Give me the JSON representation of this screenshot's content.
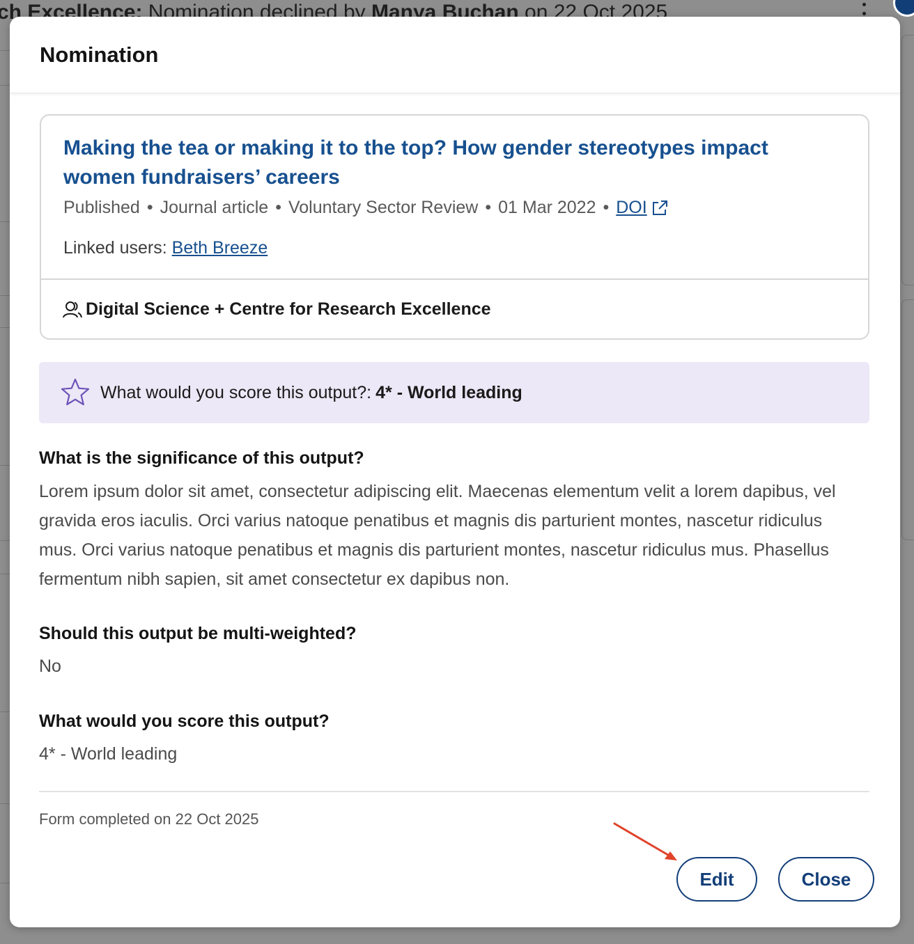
{
  "background": {
    "top_text_prefix": "ch Excellence: ",
    "top_text_middle": "Nomination declined by ",
    "top_text_name": "Manya Buchan",
    "top_text_suffix": " on 22 Oct 2025"
  },
  "modal": {
    "title": "Nomination",
    "output": {
      "title": "Making the tea or making it to the top? How gender stereotypes impact women fundraisers’ careers",
      "status": "Published",
      "type": "Journal article",
      "journal": "Voluntary Sector Review",
      "date": "01 Mar 2022",
      "doi_label": "DOI",
      "linked_users_label": "Linked users:",
      "linked_user": "Beth Breeze",
      "team": "Digital Science + Centre for Research Excellence",
      "team_icon": "users-icon",
      "doi_icon": "external-link-icon"
    },
    "score_banner": {
      "icon": "star-icon",
      "question": "What would you score this output?:",
      "value": "4* - World leading"
    },
    "questions": [
      {
        "label": "What is the significance of this output?",
        "answer": "Lorem ipsum dolor sit amet, consectetur adipiscing elit. Maecenas elementum velit a lorem dapibus, vel gravida eros iaculis. Orci varius natoque penatibus et magnis dis parturient montes, nascetur ridiculus mus. Orci varius natoque penatibus et magnis dis parturient montes, nascetur ridiculus mus. Phasellus fermentum nibh sapien, sit amet consectetur ex dapibus non."
      },
      {
        "label": "Should this output be multi-weighted?",
        "answer": "No"
      },
      {
        "label": "What would you score this output?",
        "answer": "4* - World leading"
      }
    ],
    "completed_text": "Form completed on 22 Oct 2025",
    "buttons": {
      "edit": "Edit",
      "close": "Close"
    },
    "annotation_color": "#e0432a",
    "accent_color": "#123e78",
    "link_color": "#17508f",
    "banner_color": "#ece8f7"
  }
}
